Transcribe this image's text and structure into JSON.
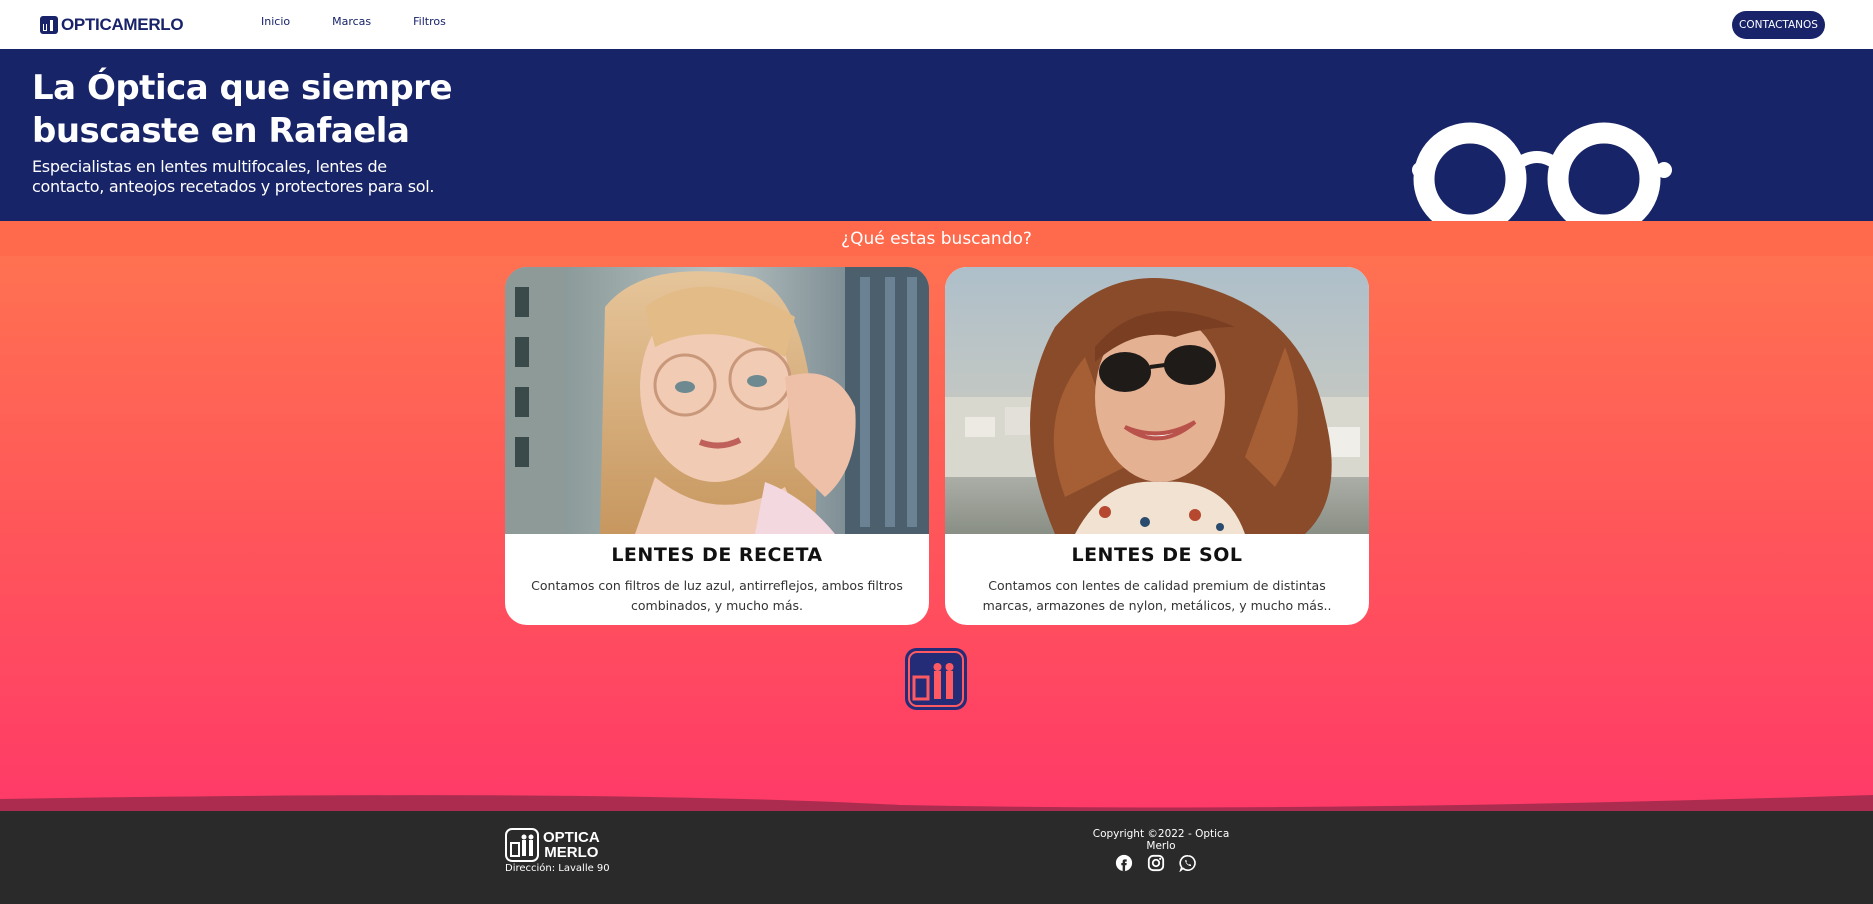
{
  "nav": {
    "brand": "OPTICAMERLO",
    "links": [
      "Inicio",
      "Marcas",
      "Filtros"
    ],
    "cta": "CONTACTANOS"
  },
  "hero": {
    "title": "La Óptica que siempre buscaste en Rafaela",
    "subtitle": "Especialistas en lentes multifocales, lentes de contacto, anteojos recetados y protectores para sol."
  },
  "section": {
    "question": "¿Qué estas buscando?"
  },
  "cards": [
    {
      "title": "LENTES DE RECETA",
      "description": "Contamos con filtros de luz azul, antirreflejos, ambos filtros combinados, y mucho más."
    },
    {
      "title": "LENTES DE SOL",
      "description": "Contamos con lentes de calidad premium de distintas marcas, armazones de nylon, metálicos, y mucho más.."
    }
  ],
  "footer": {
    "brand_line1": "OPTICA",
    "brand_line2": "MERLO",
    "address": "Dirección: Lavalle 90",
    "copyright": "Copyright ©2022 - Optica Merlo",
    "socials": [
      "facebook-icon",
      "instagram-icon",
      "whatsapp-icon"
    ]
  },
  "colors": {
    "navy": "#182468",
    "coral": "#ff6a4c",
    "pink": "#ff3a68",
    "footer": "#2a2a2a"
  }
}
